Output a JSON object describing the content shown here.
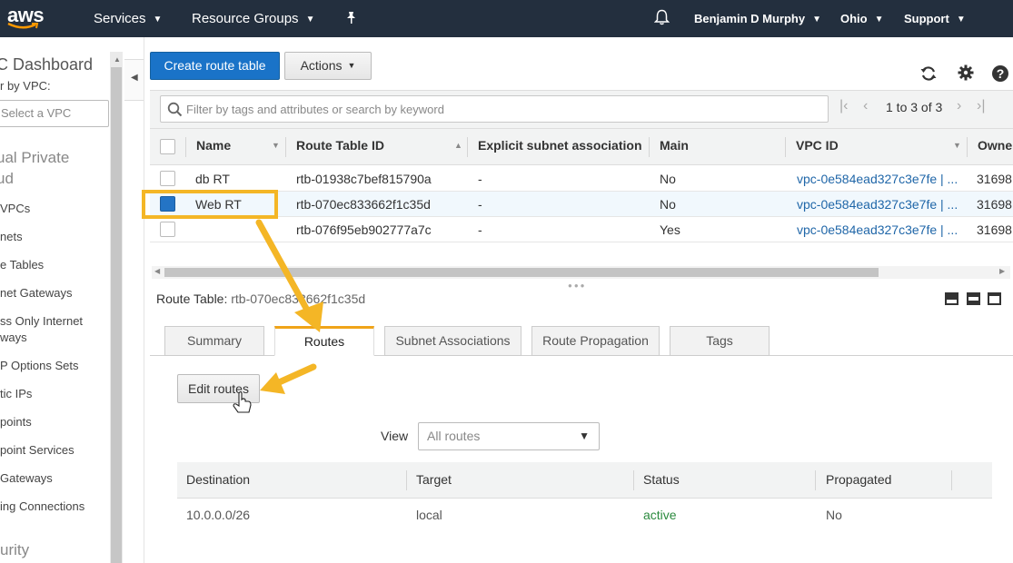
{
  "nav": {
    "logo": "aws",
    "services": "Services",
    "resource_groups": "Resource Groups",
    "user": "Benjamin D Murphy",
    "region": "Ohio",
    "support": "Support",
    "pin_icon": "pin-icon",
    "bell_icon": "bell-icon"
  },
  "sidebar": {
    "title": "C Dashboard",
    "filter_label": "r by VPC:",
    "select_placeholder": "Select a VPC",
    "section_title_1": "ual Private",
    "section_title_2": "ud",
    "items": [
      "VPCs",
      "nets",
      "e Tables",
      "net Gateways",
      "ss Only Internet",
      "ways",
      "P Options Sets",
      "tic IPs",
      "points",
      "point Services",
      "Gateways",
      "ing Connections"
    ],
    "section_security": "urity"
  },
  "toolbar": {
    "create": "Create route table",
    "actions": "Actions"
  },
  "search": {
    "placeholder": "Filter by tags and attributes or search by keyword",
    "pager": "1 to 3 of 3"
  },
  "table": {
    "headers": [
      "Name",
      "Route Table ID",
      "Explicit subnet association",
      "Main",
      "VPC ID",
      "Owne"
    ],
    "rows": [
      {
        "name": "db RT",
        "id": "rtb-01938c7bef815790a",
        "explicit": "-",
        "main": "No",
        "vpc": "vpc-0e584ead327c3e7fe | ...",
        "owner": "31698"
      },
      {
        "name": "Web RT",
        "id": "rtb-070ec833662f1c35d",
        "explicit": "-",
        "main": "No",
        "vpc": "vpc-0e584ead327c3e7fe | ...",
        "owner": "31698"
      },
      {
        "name": "",
        "id": "rtb-076f95eb902777a7c",
        "explicit": "-",
        "main": "Yes",
        "vpc": "vpc-0e584ead327c3e7fe | ...",
        "owner": "31698"
      }
    ]
  },
  "details": {
    "label": "Route Table:",
    "value": "rtb-070ec833662f1c35d",
    "tabs": [
      "Summary",
      "Routes",
      "Subnet Associations",
      "Route Propagation",
      "Tags"
    ],
    "edit_routes": "Edit routes",
    "view_label": "View",
    "view_value": "All routes"
  },
  "routes": {
    "headers": [
      "Destination",
      "Target",
      "Status",
      "Propagated"
    ],
    "rows": [
      {
        "destination": "10.0.0.0/26",
        "target": "local",
        "status": "active",
        "propagated": "No"
      }
    ]
  },
  "colors": {
    "nav_bg": "#232f3e",
    "primary": "#1a73c8",
    "annotation": "#f4b626",
    "link": "#1f66a8",
    "status_active": "#2b8a3e"
  }
}
